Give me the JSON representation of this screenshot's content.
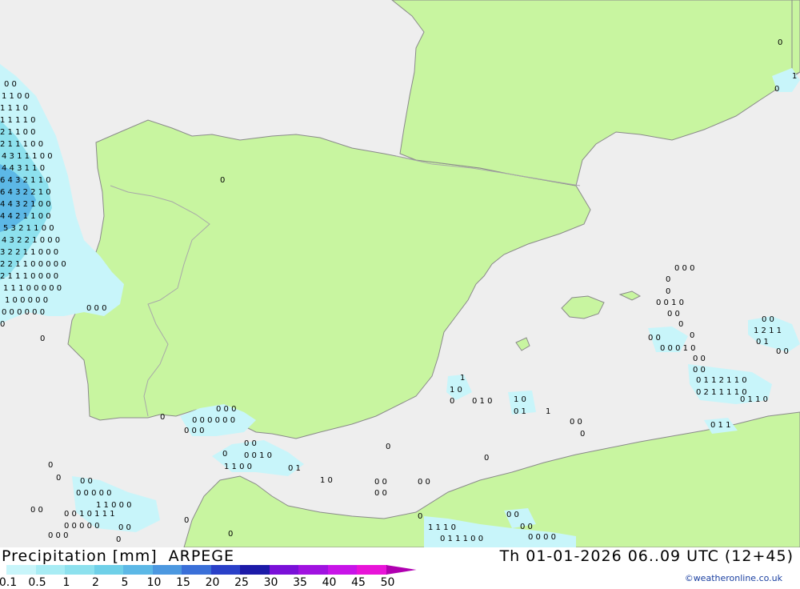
{
  "header": {
    "title": "Precipitation [mm]",
    "model": "ARPEGE",
    "valid_time": "Th 01-01-2026 06..09 UTC (12+45)",
    "credit": "©weatheronline.co.uk"
  },
  "legend": {
    "labels": [
      "0.1",
      "0.5",
      "1",
      "2",
      "5",
      "10",
      "15",
      "20",
      "25",
      "30",
      "35",
      "40",
      "45",
      "50"
    ],
    "colors": [
      "#c8f5fa",
      "#a8ecf4",
      "#8de1ee",
      "#6fd0e8",
      "#5cb8e6",
      "#4c98e0",
      "#3a6fd8",
      "#2a40c8",
      "#1c1aa8",
      "#7a10d8",
      "#a012e0",
      "#c814e8",
      "#e814d8",
      "#b000b0"
    ]
  },
  "map": {
    "colors": {
      "sea": "#eeeeee",
      "land": "#c8f5a0",
      "border": "#a8a8a8",
      "coast": "#909090",
      "rain_light": "#c8f5fa",
      "rain_mid": "#8de1ee",
      "rain_heavy": "#5cb8e6"
    }
  }
}
